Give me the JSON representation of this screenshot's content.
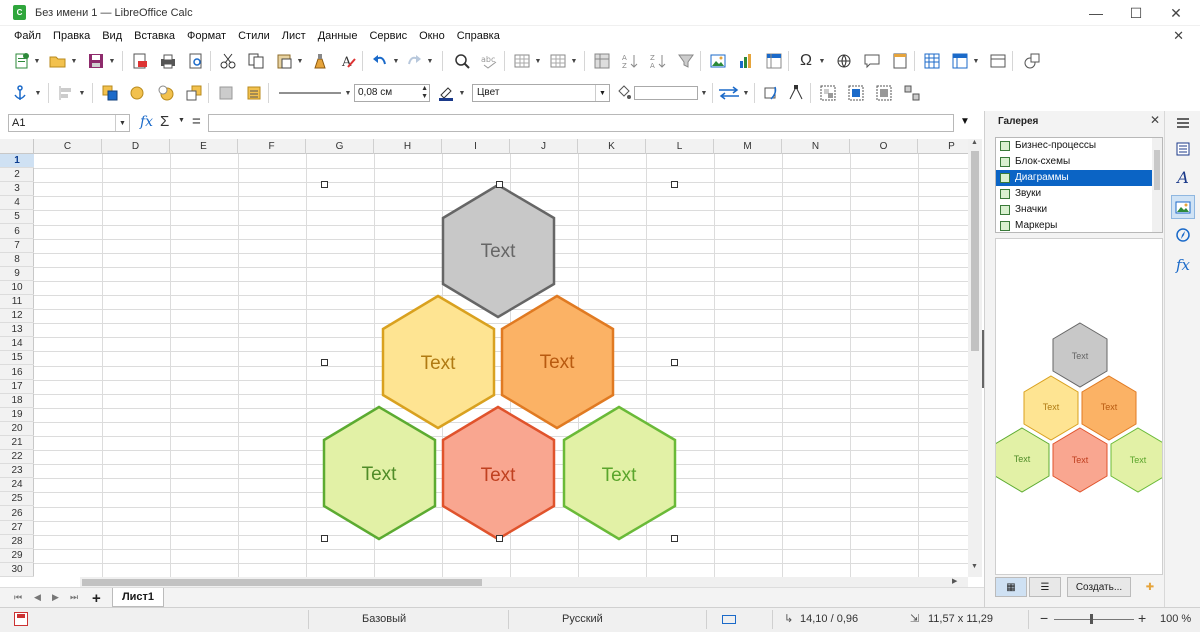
{
  "window": {
    "title": "Без имени 1 — LibreOffice Calc",
    "app_icon_text": "C"
  },
  "menu": [
    "Файл",
    "Правка",
    "Вид",
    "Вставка",
    "Формат",
    "Стили",
    "Лист",
    "Данные",
    "Сервис",
    "Окно",
    "Справка"
  ],
  "toolbar2": {
    "line_width": "0,08 см",
    "area_fill": "Цвет"
  },
  "formula_bar": {
    "cell_ref": "A1",
    "formula": ""
  },
  "columns": [
    "C",
    "D",
    "E",
    "F",
    "G",
    "H",
    "I",
    "J",
    "K",
    "L",
    "M",
    "N",
    "O",
    "P"
  ],
  "rows": [
    "1",
    "2",
    "3",
    "4",
    "5",
    "6",
    "7",
    "8",
    "9",
    "10",
    "11",
    "12",
    "13",
    "14",
    "15",
    "16",
    "17",
    "18",
    "19",
    "20",
    "21",
    "22",
    "23",
    "24",
    "25",
    "26",
    "27",
    "28",
    "29",
    "30"
  ],
  "active_row": "1",
  "hexagons": [
    {
      "label": "Text",
      "fill": "#c8c8c8",
      "stroke": "#666666",
      "text_color": "#666666"
    },
    {
      "label": "Text",
      "fill": "#fee492",
      "stroke": "#d9a11f",
      "text_color": "#b07a12"
    },
    {
      "label": "Text",
      "fill": "#fbb265",
      "stroke": "#e07a22",
      "text_color": "#b85a10"
    },
    {
      "label": "Text",
      "fill": "#e2f1a6",
      "stroke": "#5cab31",
      "text_color": "#4f8c28"
    },
    {
      "label": "Text",
      "fill": "#f9a690",
      "stroke": "#e0532c",
      "text_color": "#c04020"
    },
    {
      "label": "Text",
      "fill": "#e2f1a6",
      "stroke": "#6aba38",
      "text_color": "#5aa52c"
    }
  ],
  "sheet_tabs": {
    "active": "Лист1",
    "add_label": "+"
  },
  "status_bar": {
    "page_style": "Базовый",
    "language": "Русский",
    "position": "14,10 / 0,96",
    "size": "11,57 x 11,29",
    "zoom": "100 %"
  },
  "sidebar": {
    "title": "Галерея",
    "close": "✕",
    "themes": [
      {
        "label": "Бизнес-процессы",
        "selected": false
      },
      {
        "label": "Блок-схемы",
        "selected": false
      },
      {
        "label": "Диаграммы",
        "selected": true
      },
      {
        "label": "Звуки",
        "selected": false
      },
      {
        "label": "Значки",
        "selected": false
      },
      {
        "label": "Маркеры",
        "selected": false
      }
    ],
    "preview_label": "Text",
    "create_button": "Создать..."
  },
  "colors": {
    "accent": "#0b64c5",
    "active_row_bg": "#cfe1f3"
  },
  "icons": [
    "new-icon",
    "open-icon",
    "save-icon",
    "export-pdf-icon",
    "print-icon",
    "print-preview-icon",
    "cut-icon",
    "copy-icon",
    "paste-icon",
    "clone-icon",
    "clear-formatting-icon",
    "undo-icon",
    "redo-icon",
    "find-icon",
    "spelling-icon",
    "row-icon",
    "column-icon",
    "freeze-icon",
    "sort-asc-icon",
    "sort-desc-icon",
    "autofilter-icon",
    "image-icon",
    "chart-icon",
    "pivot-icon",
    "special-char-icon",
    "hyperlink-icon",
    "comment-icon",
    "header-footer-icon",
    "define-print-area-icon",
    "freeze-rows-icon",
    "split-window-icon",
    "show-draw-functions-icon"
  ]
}
